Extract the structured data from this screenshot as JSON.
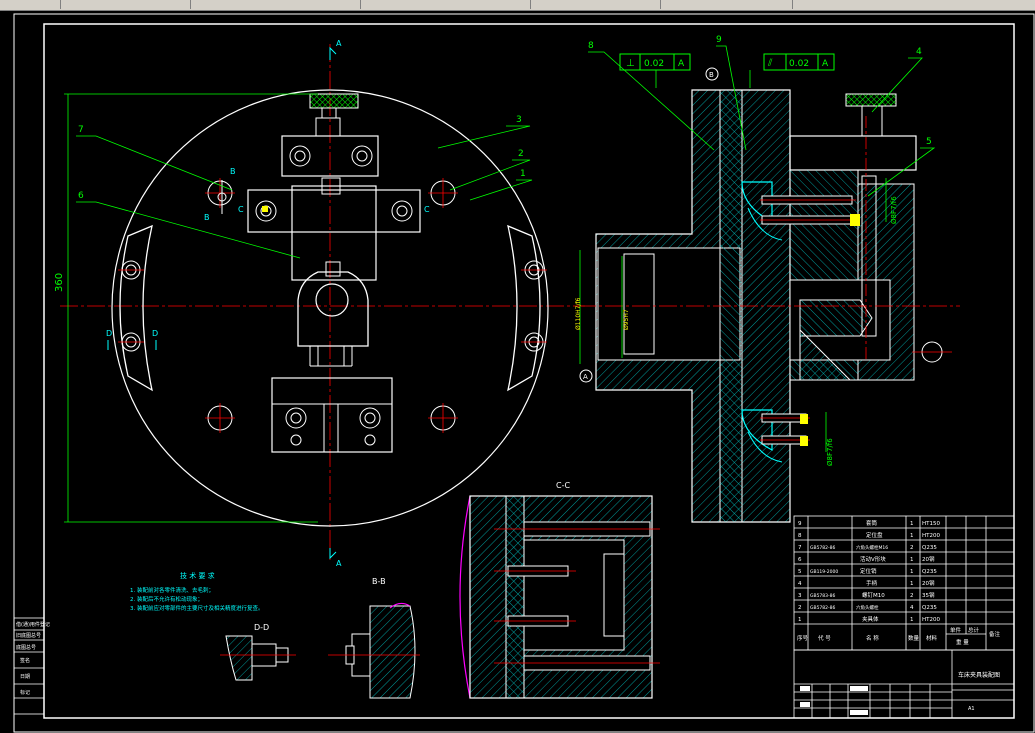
{
  "drawing": {
    "section_labels": {
      "a_top": "A",
      "a_bottom": "A",
      "b_left": "B",
      "b_right": "B",
      "c_left": "C",
      "c_right": "C",
      "d_left": "D",
      "d_right": "D",
      "cc_title": "C-C",
      "bb_title": "B-B",
      "dd_title": "D-D"
    },
    "dimensions": {
      "diameter": "360",
      "dim_fit": "Ø110H7/f6",
      "dim_bore": "Ø95H7",
      "fit_upper": "Ø8F7/f6",
      "fit_lower": "Ø8F7/f6"
    },
    "datum": {
      "a": "A",
      "b": "B"
    },
    "tolerances": [
      {
        "symbol": "⊥",
        "value": "0.02",
        "datum": "A"
      },
      {
        "symbol": "⫽",
        "value": "0.02",
        "datum": "A"
      }
    ],
    "balloons": [
      "1",
      "2",
      "3",
      "4",
      "5",
      "6",
      "7",
      "8",
      "9"
    ],
    "tech_requirements": {
      "title": "技 术 要 求",
      "lines": [
        "1. 装配前对各零件清洗、去毛刺；",
        "2. 装配后不允许有松动现象；",
        "3. 装配前应对零部件的主要尺寸及相关精度进行复查。"
      ]
    },
    "bom": {
      "rows": [
        {
          "no": "9",
          "code": "",
          "name": "套筒",
          "qty": "1",
          "material": "HT150"
        },
        {
          "no": "8",
          "code": "",
          "name": "定位盘",
          "qty": "1",
          "material": "HT200"
        },
        {
          "no": "7",
          "code": "GB5782-86",
          "name": "六角头螺栓M16",
          "qty": "2",
          "material": "Q235"
        },
        {
          "no": "6",
          "code": "",
          "name": "活动V形块",
          "qty": "1",
          "material": "20钢"
        },
        {
          "no": "5",
          "code": "GB119-2000",
          "name": "定位销",
          "qty": "1",
          "material": "Q235"
        },
        {
          "no": "4",
          "code": "",
          "name": "手柄",
          "qty": "1",
          "material": "20钢"
        },
        {
          "no": "3",
          "code": "GB5783-86",
          "name": "螺钉M10",
          "qty": "2",
          "material": "35钢"
        },
        {
          "no": "2",
          "code": "GB5782-86",
          "name": "六角头螺栓",
          "qty": "4",
          "material": "Q235"
        },
        {
          "no": "1",
          "code": "",
          "name": "夹具体",
          "qty": "1",
          "material": "HT200"
        }
      ],
      "header": {
        "no": "序号",
        "code": "代 号",
        "name": "名 称",
        "qty": "数量",
        "material": "材料",
        "unit_weight": "单件",
        "total_weight": "总计",
        "weight": "重 量",
        "remark": "备注"
      }
    },
    "title_block": {
      "drawing_name": "车床夹具装配图",
      "scale": "1:1",
      "sheet": "A1"
    },
    "side_tags": [
      "借(通)用件登记",
      "旧底图总号",
      "底图总号",
      "签名",
      "日期",
      "标记"
    ]
  },
  "colors": {
    "outline": "#ffffff",
    "centerline": "#ff0000",
    "dimension": "#00ff00",
    "hatch": "#00c0c0",
    "part": "#00ffff",
    "magenta": "#ff00ff",
    "fill_yellow": "#ffff00",
    "knurl": "#00ff00"
  }
}
